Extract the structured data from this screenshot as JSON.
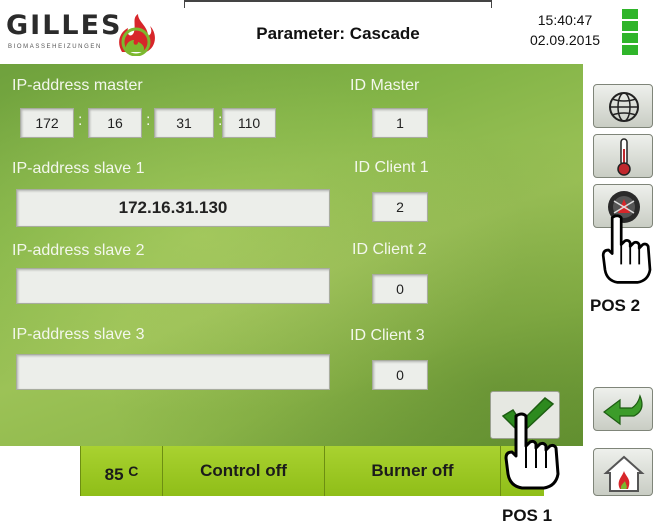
{
  "header": {
    "brand": "GILLES",
    "brand_sub": "BIOMASSEHEIZUNGEN",
    "title": "Parameter: Cascade",
    "time": "15:40:47",
    "date": "02.09.2015"
  },
  "master": {
    "label": "IP-address master",
    "octets": [
      "172",
      "16",
      "31",
      "110"
    ],
    "id_label": "ID Master",
    "id_value": "1"
  },
  "slave1": {
    "label": "IP-address slave 1",
    "ip": "172.16.31.130",
    "id_label": "ID Client 1",
    "id_value": "2"
  },
  "slave2": {
    "label": "IP-address slave 2",
    "ip": "",
    "id_label": "ID Client 2",
    "id_value": "0"
  },
  "slave3": {
    "label": "IP-address slave 3",
    "ip": "",
    "id_label": "ID Client 3",
    "id_value": "0"
  },
  "status": {
    "temperature": "85",
    "temperature_unit": "C",
    "control": "Control off",
    "burner": "Burner off"
  },
  "annotations": {
    "pos1": "POS 1",
    "pos2": "POS 2"
  },
  "sidebar": {
    "icons": [
      "globe-icon",
      "thermometer-icon",
      "burner-settings-icon",
      "back-arrow-icon",
      "home-flame-icon"
    ]
  },
  "colors": {
    "accent_green": "#9acb24",
    "checkmark_green": "#2d8a1e",
    "battery_green": "#2fb52a"
  }
}
